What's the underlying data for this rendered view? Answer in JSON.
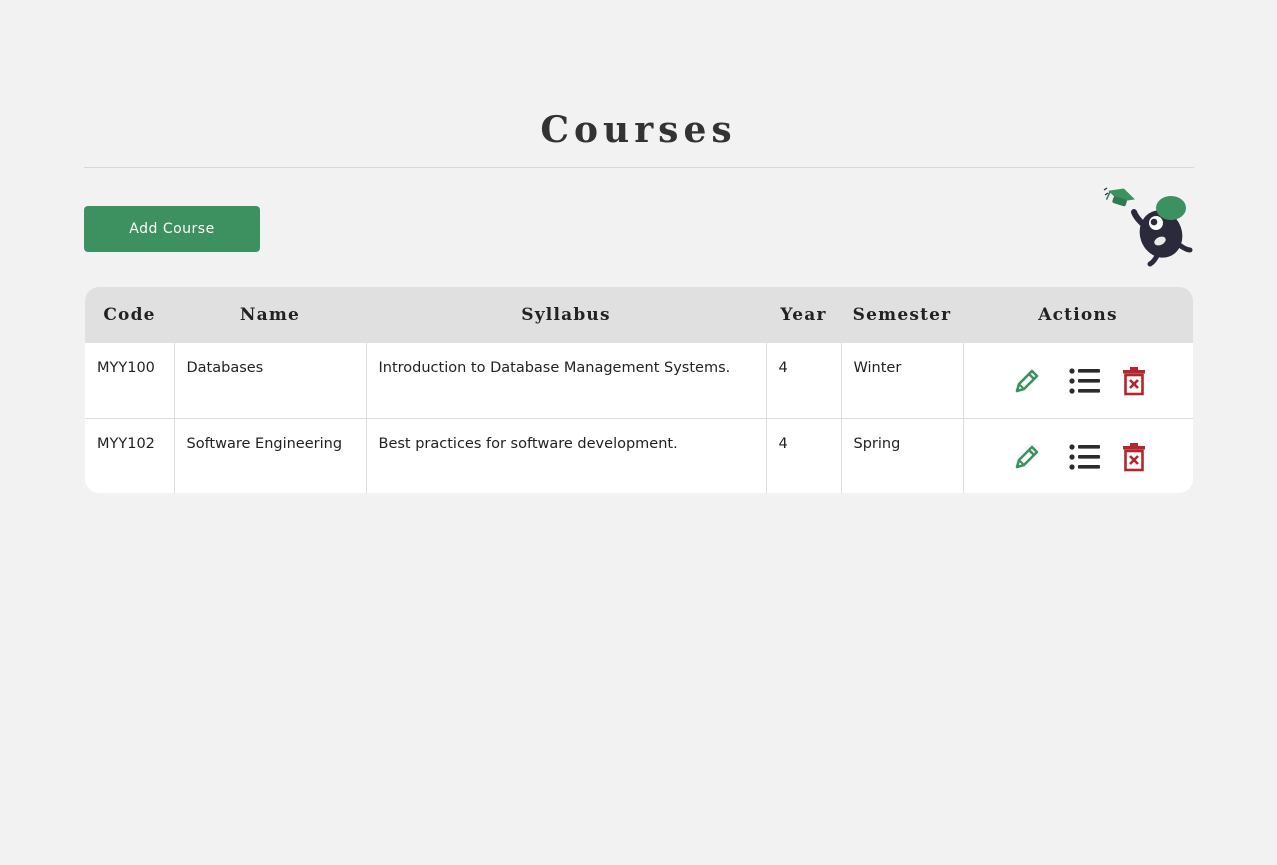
{
  "page": {
    "title": "Courses"
  },
  "toolbar": {
    "add_label": "Add Course"
  },
  "table": {
    "headers": {
      "code": "Code",
      "name": "Name",
      "syllabus": "Syllabus",
      "year": "Year",
      "semester": "Semester",
      "actions": "Actions"
    },
    "rows": [
      {
        "code": "MYY100",
        "name": "Databases",
        "syllabus": "Introduction to Database Management Systems.",
        "year": "4",
        "semester": "Winter"
      },
      {
        "code": "MYY102",
        "name": "Software Engineering",
        "syllabus": "Best practices for software development.",
        "year": "4",
        "semester": "Spring"
      }
    ],
    "row_actions": [
      "pencil-icon",
      "list-icon",
      "trash-icon"
    ]
  },
  "icons": {
    "mascot": "graduation-mascot-icon"
  },
  "colors": {
    "background": "#f2f2f2",
    "accent": "#3d9160",
    "header_bg": "#e0e0e0",
    "danger": "#b3262e",
    "dark": "#2b2a3a"
  }
}
